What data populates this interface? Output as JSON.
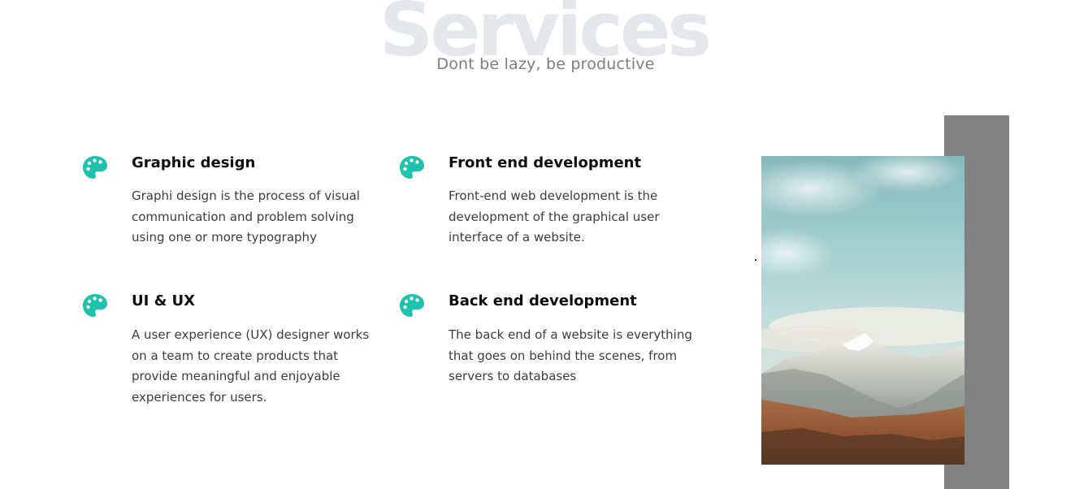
{
  "header": {
    "background_title": "Services",
    "subtitle": "Dont be lazy, be productive"
  },
  "services": [
    {
      "icon": "palette-icon",
      "title": "Graphic design",
      "description": "Graphi design is the process of visual communication and problem solving using one or more typography"
    },
    {
      "icon": "palette-icon",
      "title": "Front end development",
      "description": "Front-end web development is the development of the graphical user interface of a website."
    },
    {
      "icon": "palette-icon",
      "title": "UI & UX",
      "description": "A user experience (UX) designer works on a team to create products that provide meaningful and enjoyable experiences for users."
    },
    {
      "icon": "palette-icon",
      "title": "Back end development",
      "description": "The back end of a website is everything that goes on behind the scenes, from servers to databases"
    }
  ],
  "colors": {
    "accent": "#1fc2ad",
    "background_title": "#e6e7ea",
    "subtitle": "#7d7d7d",
    "heading": "#0f0f0f",
    "body_text": "#3c3c3c",
    "gray_block": "#828282"
  },
  "image": {
    "subject": "snow-capped mountain landscape with autumn forest"
  }
}
